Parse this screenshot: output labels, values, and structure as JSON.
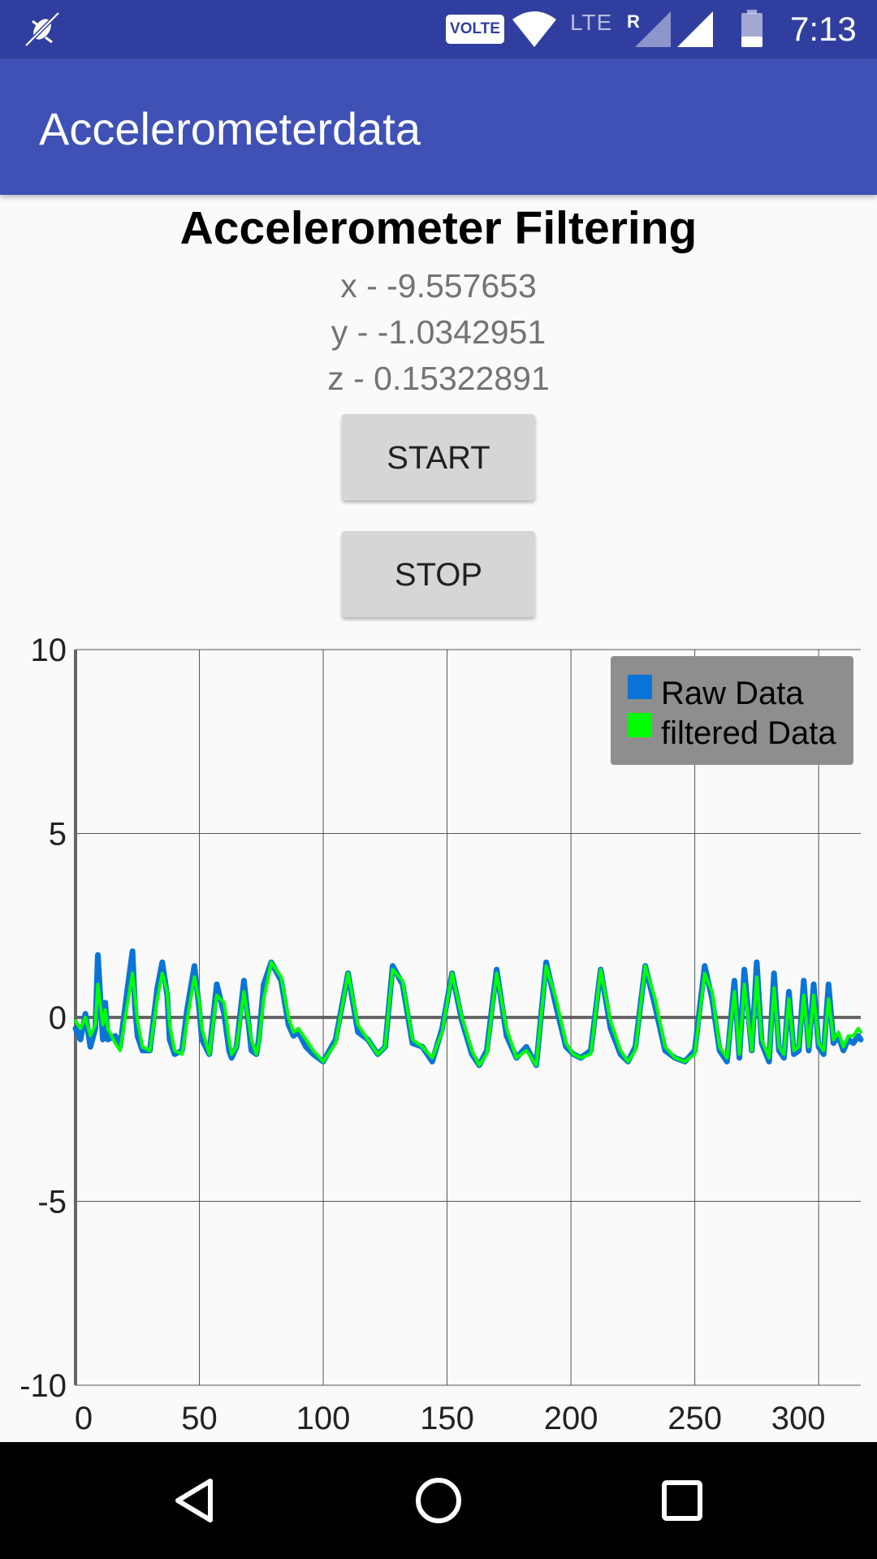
{
  "status_bar": {
    "volte_label": "VOLTE",
    "lte_label": "LTE",
    "roaming_label": "R",
    "time": "7:13"
  },
  "app_bar": {
    "title": "Accelerometerdata"
  },
  "main": {
    "heading": "Accelerometer Filtering",
    "x_reading": "x - -9.557653",
    "y_reading": "y - -1.0342951",
    "z_reading": "z - 0.15322891",
    "start_label": "START",
    "stop_label": "STOP"
  },
  "colors": {
    "status_bar": "#303f9f",
    "app_bar": "#3f51b5",
    "raw_series": "#0a74d8",
    "filtered_series": "#00ff00",
    "legend_bg": "#8e8e8e"
  },
  "chart_data": {
    "type": "line",
    "xlim": [
      0,
      317
    ],
    "ylim": [
      -10,
      10
    ],
    "x_ticks": [
      "0",
      "50",
      "100",
      "150",
      "200",
      "250",
      "300"
    ],
    "y_ticks": [
      "10",
      "5",
      "0",
      "-5",
      "-10"
    ],
    "grid": true,
    "legend_position": "top-right",
    "series": [
      {
        "name": "Raw Data",
        "color": "#0a74d8",
        "x": [
          0,
          2,
          4,
          6,
          8,
          9,
          11,
          12,
          13,
          16,
          18,
          21,
          23,
          24,
          25,
          27,
          30,
          33,
          35,
          37,
          38,
          40,
          43,
          45,
          48,
          50,
          51,
          54,
          57,
          60,
          62,
          63,
          65,
          68,
          71,
          73,
          74,
          76,
          79,
          83,
          86,
          88,
          90,
          93,
          96,
          100,
          105,
          110,
          114,
          118,
          122,
          125,
          128,
          132,
          136,
          140,
          144,
          148,
          152,
          156,
          160,
          163,
          166,
          170,
          174,
          178,
          182,
          186,
          190,
          194,
          198,
          201,
          204,
          208,
          212,
          216,
          220,
          223,
          226,
          230,
          234,
          238,
          242,
          246,
          250,
          254,
          257,
          260,
          263,
          266,
          268,
          270,
          273,
          275,
          277,
          280,
          282,
          284,
          286,
          288,
          290,
          292,
          294,
          296,
          298,
          300,
          302,
          304,
          306,
          308,
          310,
          312,
          314,
          316,
          317
        ],
        "y": [
          -0.3,
          -0.6,
          0.1,
          -0.8,
          -0.3,
          1.7,
          -0.6,
          0.4,
          -0.6,
          -0.5,
          -0.8,
          0.8,
          1.8,
          0.3,
          -0.5,
          -0.9,
          -0.9,
          0.8,
          1.5,
          0.6,
          -0.6,
          -1.0,
          -0.9,
          0.2,
          1.4,
          0.2,
          -0.6,
          -1.0,
          0.9,
          0.1,
          -0.9,
          -1.1,
          -0.8,
          1.0,
          -0.9,
          -1.0,
          -0.6,
          0.9,
          1.5,
          1.0,
          -0.2,
          -0.5,
          -0.4,
          -0.8,
          -1.0,
          -1.2,
          -0.6,
          1.2,
          -0.4,
          -0.6,
          -1.0,
          -0.8,
          1.4,
          0.9,
          -0.7,
          -0.8,
          -1.2,
          -0.3,
          1.2,
          -0.1,
          -1.0,
          -1.3,
          -0.9,
          1.3,
          -0.5,
          -1.1,
          -0.8,
          -1.3,
          1.5,
          0.3,
          -0.8,
          -1.0,
          -1.1,
          -0.9,
          1.3,
          -0.3,
          -1.0,
          -1.2,
          -0.8,
          1.4,
          0.3,
          -0.9,
          -1.1,
          -1.2,
          -0.9,
          1.4,
          0.5,
          -0.9,
          -1.2,
          1.0,
          -1.1,
          1.3,
          -0.9,
          1.5,
          -0.7,
          -1.2,
          1.2,
          -0.9,
          -1.1,
          0.7,
          -1.0,
          -0.9,
          1.0,
          -0.9,
          0.9,
          -0.8,
          -1.0,
          0.9,
          -0.7,
          -0.5,
          -0.9,
          -0.6,
          -0.7,
          -0.5,
          -0.6
        ]
      },
      {
        "name": "filtered Data",
        "color": "#00ff00",
        "x": [
          0,
          2,
          4,
          6,
          8,
          9,
          11,
          12,
          13,
          16,
          18,
          21,
          23,
          24,
          25,
          27,
          30,
          33,
          35,
          37,
          38,
          40,
          43,
          45,
          48,
          50,
          51,
          54,
          57,
          60,
          62,
          63,
          65,
          68,
          71,
          73,
          74,
          76,
          79,
          83,
          86,
          88,
          90,
          93,
          96,
          100,
          105,
          110,
          114,
          118,
          122,
          125,
          128,
          132,
          136,
          140,
          144,
          148,
          152,
          156,
          160,
          163,
          166,
          170,
          174,
          178,
          182,
          186,
          190,
          194,
          198,
          201,
          204,
          208,
          212,
          216,
          220,
          223,
          226,
          230,
          234,
          238,
          242,
          246,
          250,
          254,
          257,
          260,
          263,
          266,
          268,
          270,
          273,
          275,
          277,
          280,
          282,
          284,
          286,
          288,
          290,
          292,
          294,
          296,
          298,
          300,
          302,
          304,
          306,
          308,
          310,
          312,
          314,
          316,
          317
        ],
        "y": [
          -0.1,
          -0.3,
          0.0,
          -0.5,
          -0.2,
          0.9,
          -0.2,
          0.2,
          -0.3,
          -0.7,
          -0.9,
          0.4,
          1.2,
          0.6,
          -0.1,
          -0.8,
          -0.9,
          0.5,
          1.2,
          0.7,
          -0.2,
          -0.9,
          -1.0,
          -0.1,
          1.1,
          0.4,
          -0.3,
          -1.0,
          0.6,
          0.4,
          -0.6,
          -1.0,
          -0.8,
          0.7,
          -0.6,
          -1.0,
          -0.7,
          0.5,
          1.5,
          1.1,
          0.0,
          -0.4,
          -0.3,
          -0.6,
          -0.9,
          -1.2,
          -0.7,
          1.2,
          -0.2,
          -0.6,
          -1.0,
          -0.8,
          1.3,
          1.0,
          -0.6,
          -0.8,
          -1.1,
          -0.4,
          1.2,
          0.0,
          -0.9,
          -1.3,
          -1.0,
          1.2,
          -0.3,
          -1.1,
          -0.9,
          -1.3,
          1.4,
          0.5,
          -0.7,
          -1.0,
          -1.1,
          -1.0,
          1.3,
          -0.1,
          -0.9,
          -1.2,
          -0.9,
          1.4,
          0.5,
          -0.8,
          -1.1,
          -1.2,
          -1.0,
          1.2,
          0.7,
          -0.8,
          -1.1,
          0.7,
          -1.0,
          0.9,
          -0.9,
          1.1,
          -0.6,
          -1.1,
          0.8,
          -0.8,
          -1.0,
          0.5,
          -0.9,
          -0.8,
          0.6,
          -0.8,
          0.6,
          -0.7,
          -0.9,
          0.5,
          -0.6,
          -0.4,
          -0.8,
          -0.5,
          -0.5,
          -0.3,
          -0.4
        ]
      }
    ]
  }
}
